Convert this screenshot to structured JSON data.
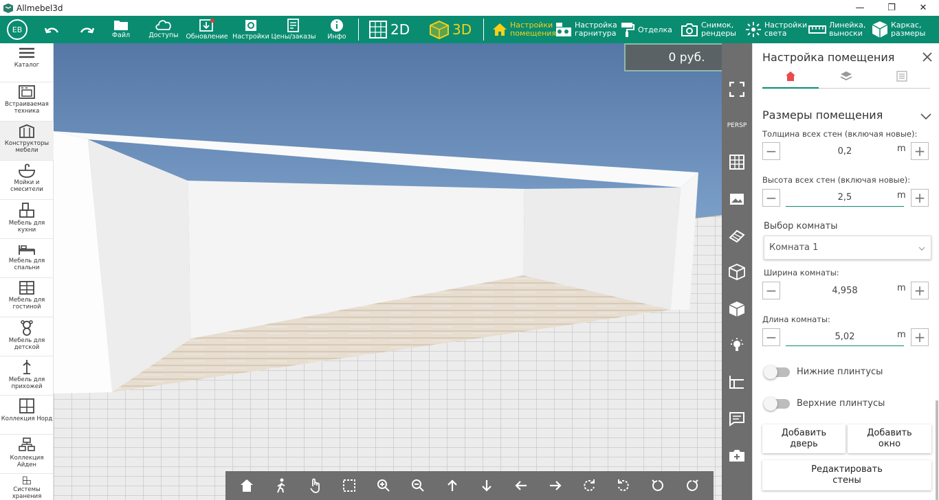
{
  "app": {
    "title": "Allmebel3d"
  },
  "topbar": {
    "avatar_initials": "EB",
    "file": "Файл",
    "access": "Доступы",
    "update": "Обновление",
    "settings": "Настройки",
    "prices": "Цены/заказы",
    "info": "Инфо",
    "mode_2d": "2D",
    "mode_3d": "3D",
    "room_settings": [
      "Настройки",
      "помещения"
    ],
    "set_settings": [
      "Настройка",
      "гарнитура"
    ],
    "finishing": "Отделка",
    "snapshot": [
      "Снимок,",
      "рендеры"
    ],
    "light": [
      "Настройки",
      "света"
    ],
    "ruler": [
      "Линейка,",
      "выноски"
    ],
    "frame": [
      "Каркас,",
      "размеры"
    ]
  },
  "sidebar": {
    "items": [
      {
        "label": "Каталог",
        "icon": "menu-icon"
      },
      {
        "label": "Встраиваемая техника",
        "icon": "oven-icon"
      },
      {
        "label": "Конструкторы мебели",
        "icon": "constructor-icon"
      },
      {
        "label": "Мойки и смесители",
        "icon": "sink-icon"
      },
      {
        "label": "Мебель для кухни",
        "icon": "kitchen-icon"
      },
      {
        "label": "Мебель для спальни",
        "icon": "bed-icon"
      },
      {
        "label": "Мебель для гостиной",
        "icon": "shelf-icon"
      },
      {
        "label": "Мебель для детской",
        "icon": "bear-icon"
      },
      {
        "label": "Мебель для прихожей",
        "icon": "hanger-icon"
      },
      {
        "label": "Коллекция Норд",
        "icon": "cabinet-icon"
      },
      {
        "label": "Коллекция Айден",
        "icon": "structure-icon"
      },
      {
        "label": "Системы хранения",
        "icon": "storage-icon"
      }
    ]
  },
  "price": {
    "text": "0 руб."
  },
  "viewport_tools": {
    "persp_label": "PERSP"
  },
  "panel": {
    "title": "Настройка помещения",
    "section_title": "Размеры помещения",
    "wall_thickness": {
      "label": "Толщина всех стен (включая новые):",
      "value": "0,2",
      "unit": "m"
    },
    "wall_height": {
      "label": "Высота всех стен (включая новые):",
      "value": "2,5",
      "unit": "m"
    },
    "room_select": {
      "label": "Выбор комнаты",
      "value": "Комната 1"
    },
    "room_width": {
      "label": "Ширина комнаты:",
      "value": "4,958",
      "unit": "m"
    },
    "room_length": {
      "label": "Длина комнаты:",
      "value": "5,02",
      "unit": "m"
    },
    "bottom_plinth": {
      "label": "Нижние плинтусы",
      "on": false
    },
    "top_plinth": {
      "label": "Верхние плинтусы",
      "on": false
    },
    "add_door": [
      "Добавить",
      "дверь"
    ],
    "add_window": [
      "Добавить",
      "окно"
    ],
    "edit_walls": [
      "Редактировать",
      "стены"
    ]
  },
  "colors": {
    "accent": "#0a8c71",
    "mode_active": "#f7d117",
    "tab_active": "#e84c4c"
  }
}
